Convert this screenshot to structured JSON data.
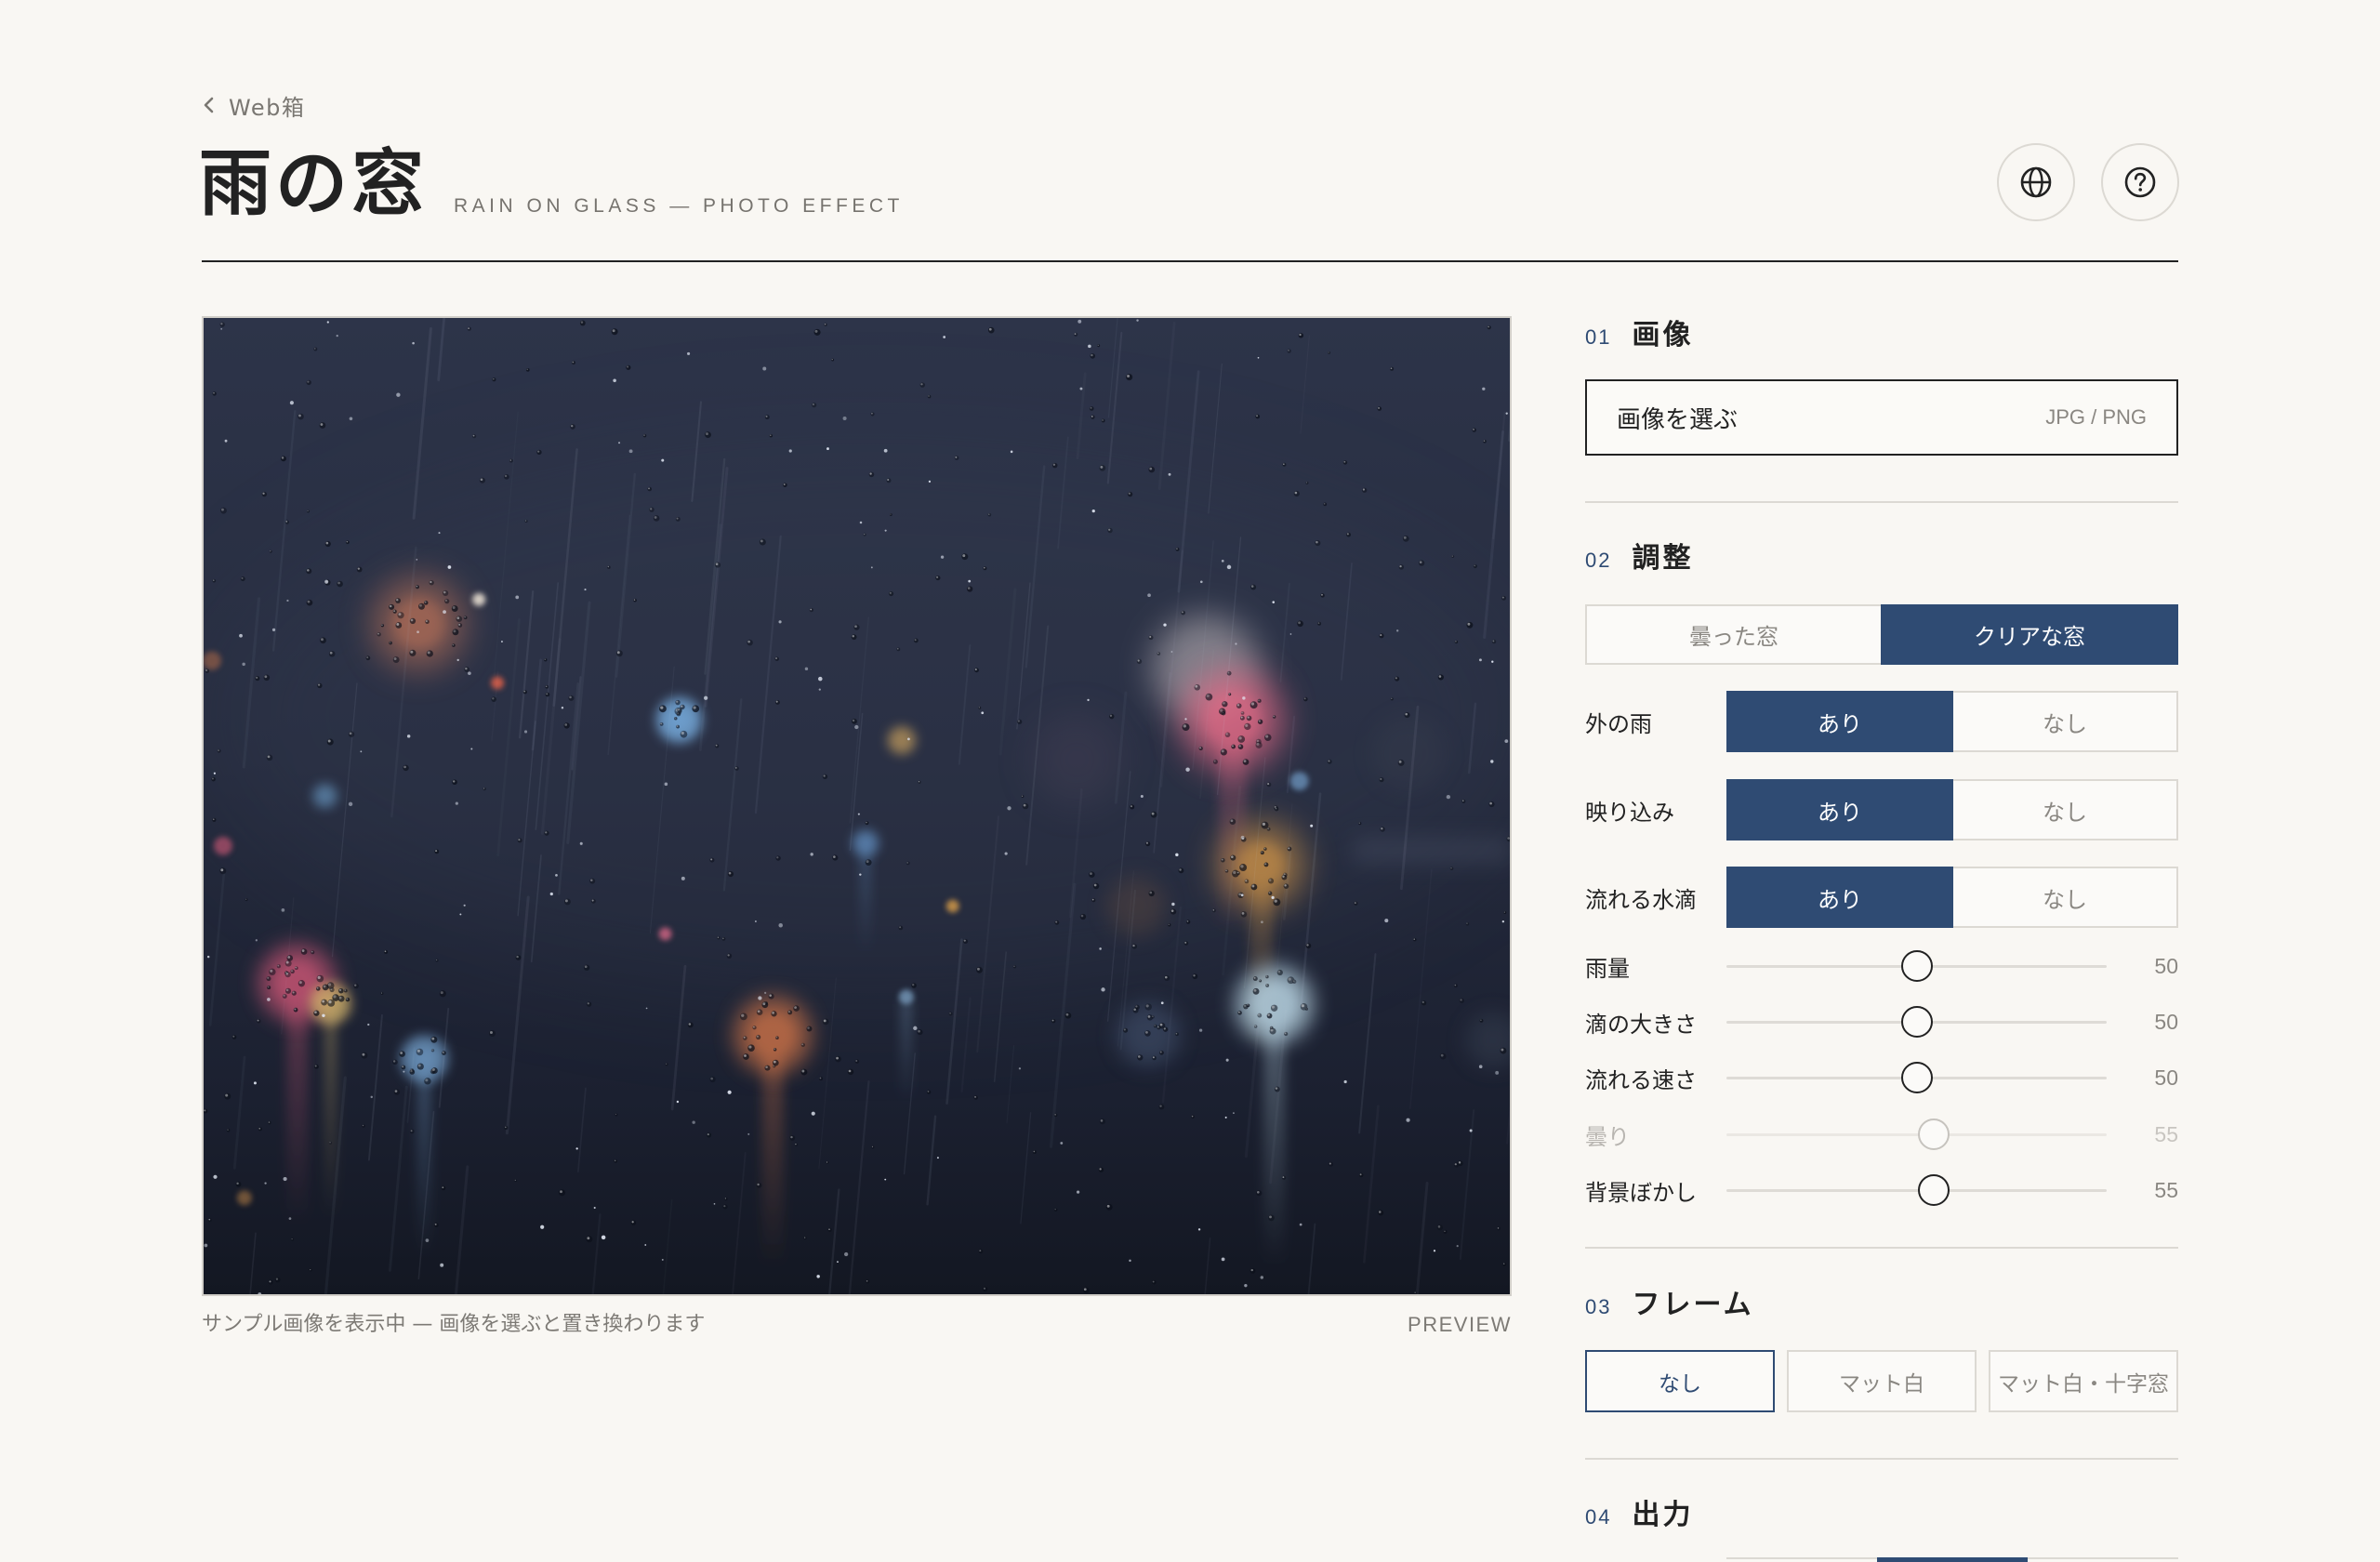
{
  "header": {
    "back_label": "Web箱",
    "title": "雨の窓",
    "subtitle": "RAIN ON GLASS — PHOTO EFFECT",
    "icons": {
      "back": "chevron-left-icon",
      "language": "globe-icon",
      "help": "question-circle-icon"
    }
  },
  "preview": {
    "caption": "サンプル画像を表示中 — 画像を選ぶと置き換わります",
    "label": "PREVIEW"
  },
  "panel": {
    "image": {
      "number": "01",
      "heading": "画像",
      "file_button": "画像を選ぶ",
      "formats": "JPG / PNG"
    },
    "adjust": {
      "number": "02",
      "heading": "調整",
      "mode": {
        "options": [
          "曇った窓",
          "クリアな窓"
        ],
        "selected": 1
      },
      "toggles": [
        {
          "label": "外の雨",
          "options": [
            "あり",
            "なし"
          ],
          "selected": 0
        },
        {
          "label": "映り込み",
          "options": [
            "あり",
            "なし"
          ],
          "selected": 0
        },
        {
          "label": "流れる水滴",
          "options": [
            "あり",
            "なし"
          ],
          "selected": 0
        }
      ],
      "sliders": [
        {
          "label": "雨量",
          "value": 50,
          "disabled": false
        },
        {
          "label": "滴の大きさ",
          "value": 50,
          "disabled": false
        },
        {
          "label": "流れる速さ",
          "value": 50,
          "disabled": false
        },
        {
          "label": "曇り",
          "value": 55,
          "disabled": true
        },
        {
          "label": "背景ぼかし",
          "value": 55,
          "disabled": false
        }
      ]
    },
    "frame": {
      "number": "03",
      "heading": "フレーム",
      "options": [
        "なし",
        "マット白",
        "マット白・十字窓"
      ],
      "selected": 0
    },
    "output": {
      "number": "04",
      "heading": "出力",
      "selected": 1
    }
  },
  "colors": {
    "background": "#f9f7f3",
    "accent": "#2f4b73",
    "text": "#222222",
    "muted": "#8a8782",
    "border": "#dcd9d3"
  }
}
